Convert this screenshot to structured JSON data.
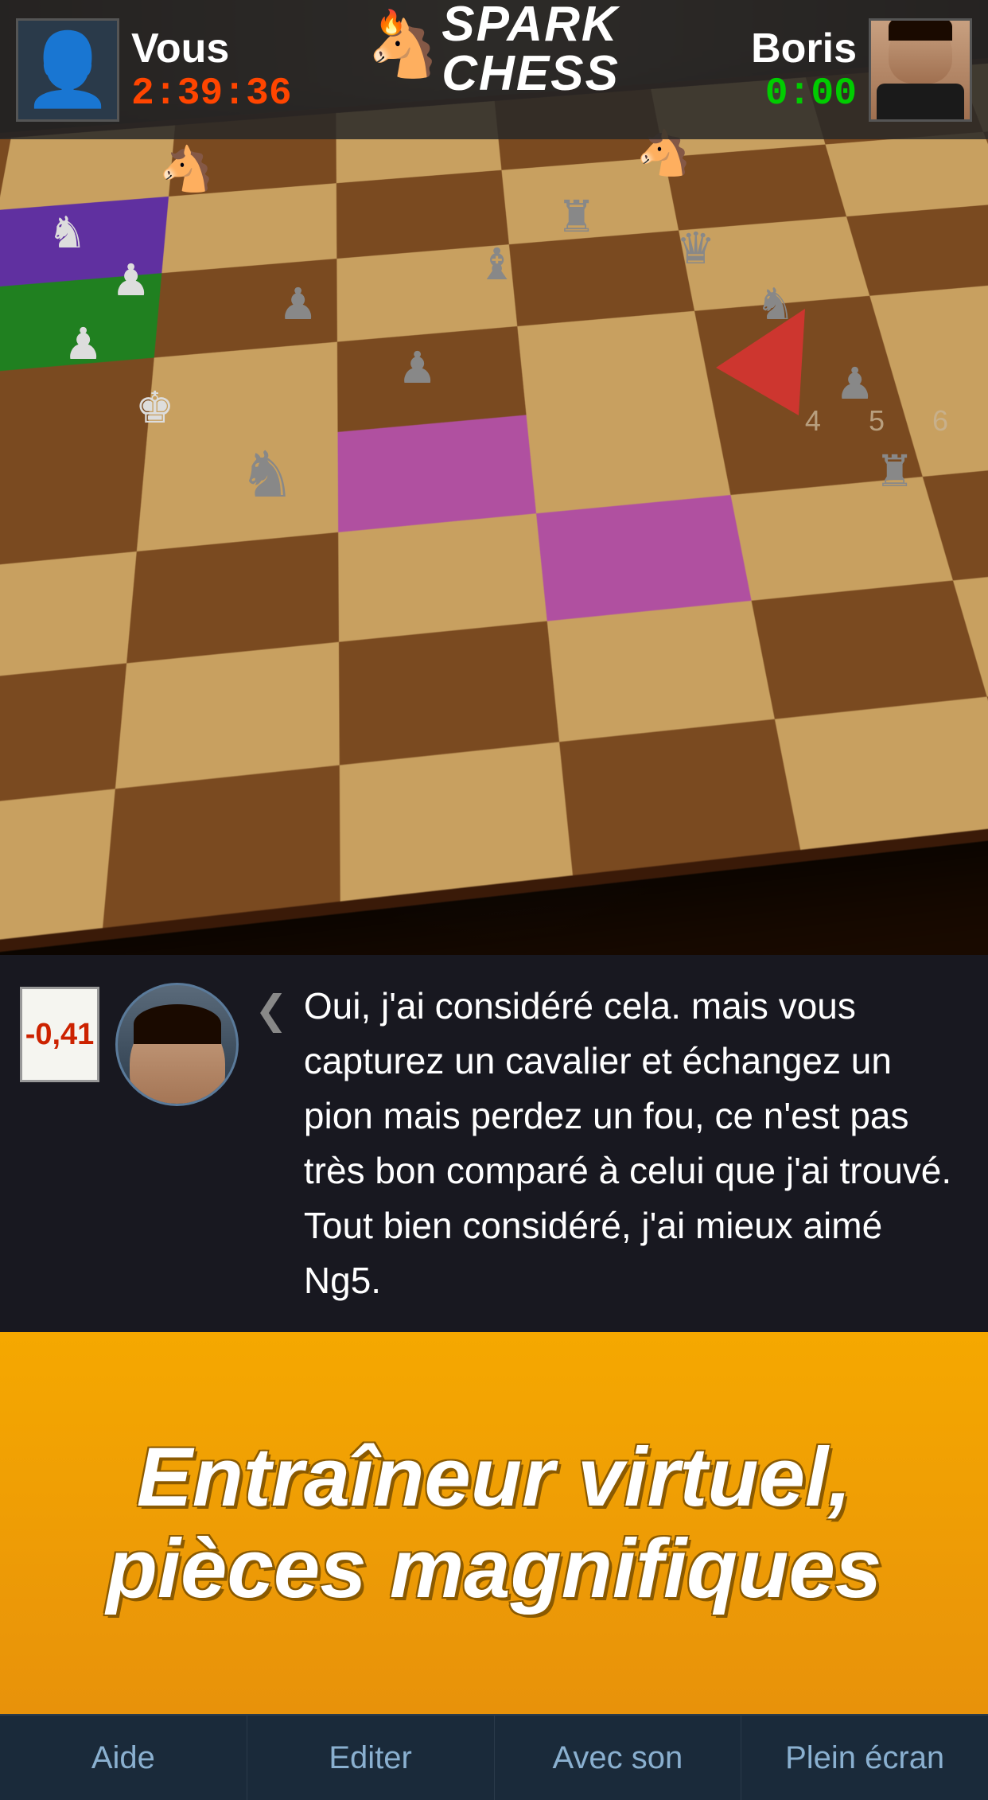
{
  "app": {
    "name": "SparkChess",
    "logo": {
      "spark": "SPARK",
      "chess": "CHESS",
      "registered": "®"
    }
  },
  "header": {
    "player_left": {
      "name": "Vous",
      "timer": "2:39:36",
      "timer_color": "#FF4500"
    },
    "player_right": {
      "name": "Boris",
      "timer": "0:00",
      "timer_color": "#00CC00"
    }
  },
  "game": {
    "score": "-0,41"
  },
  "coach": {
    "message": "Oui, j'ai considéré cela. mais vous capturez un cavalier et échangez un pion mais perdez un fou, ce n'est pas très bon comparé à celui que j'ai trouvé. Tout bien considéré, j'ai mieux aimé Ng5."
  },
  "marketing": {
    "line1": "Entraîneur virtuel,",
    "line2": "pièces magnifiques"
  },
  "nav": {
    "items": [
      {
        "label": "Aide"
      },
      {
        "label": "Editer"
      },
      {
        "label": "Avec son"
      },
      {
        "label": "Plein écran"
      }
    ]
  },
  "board": {
    "numbers": [
      "4",
      "5",
      "6"
    ]
  }
}
